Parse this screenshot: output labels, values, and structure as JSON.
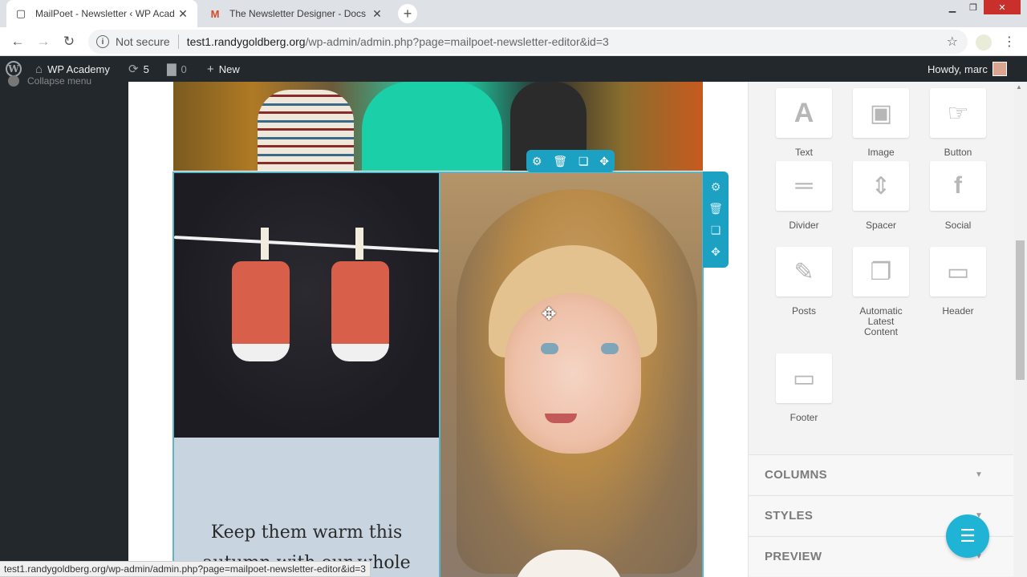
{
  "browser": {
    "tabs": [
      {
        "title": "MailPoet - Newsletter ‹ WP Acad",
        "favicon": "page-icon",
        "active": true
      },
      {
        "title": "The Newsletter Designer - Docs",
        "favicon": "mailpoet-m-icon",
        "favicon_text": "M",
        "active": false
      }
    ],
    "new_tab_symbol": "+",
    "close_symbol": "✕",
    "address": {
      "security_label": "Not secure",
      "host": "test1.randygoldberg.org",
      "path": "/wp-admin/admin.php?page=mailpoet-newsletter-editor&id=3"
    },
    "status_url": "test1.randygoldberg.org/wp-admin/admin.php?page=mailpoet-newsletter-editor&id=3"
  },
  "adminbar": {
    "site_name": "WP Academy",
    "updates_count": "5",
    "comments_count": "0",
    "new_label": "New",
    "greeting": "Howdy, marc"
  },
  "leftmenu": {
    "collapse_label": "Collapse menu"
  },
  "canvas": {
    "text_block": "Keep them warm this autumn with our whole"
  },
  "sidebar": {
    "widgets": [
      {
        "label": "Text",
        "icon": "text-icon",
        "glyph": "A"
      },
      {
        "label": "Image",
        "icon": "image-icon",
        "glyph": "▣"
      },
      {
        "label": "Button",
        "icon": "button-icon",
        "glyph": "☞"
      },
      {
        "label": "Divider",
        "icon": "divider-icon",
        "glyph": "═"
      },
      {
        "label": "Spacer",
        "icon": "spacer-icon",
        "glyph": "⇕"
      },
      {
        "label": "Social",
        "icon": "facebook-icon",
        "glyph": "f"
      },
      {
        "label": "Posts",
        "icon": "posts-icon",
        "glyph": "✎"
      },
      {
        "label": "Automatic Latest Content",
        "icon": "automatic-posts-icon",
        "glyph": "❐"
      },
      {
        "label": "Header",
        "icon": "header-icon",
        "glyph": "▭"
      },
      {
        "label": "Footer",
        "icon": "footer-icon",
        "glyph": "▭"
      }
    ],
    "sections": [
      {
        "label": "COLUMNS"
      },
      {
        "label": "STYLES"
      },
      {
        "label": "PREVIEW"
      }
    ]
  },
  "colors": {
    "accent": "#1da1c2",
    "admin_bar": "#23282d",
    "chat_button": "#1fb3d5"
  }
}
